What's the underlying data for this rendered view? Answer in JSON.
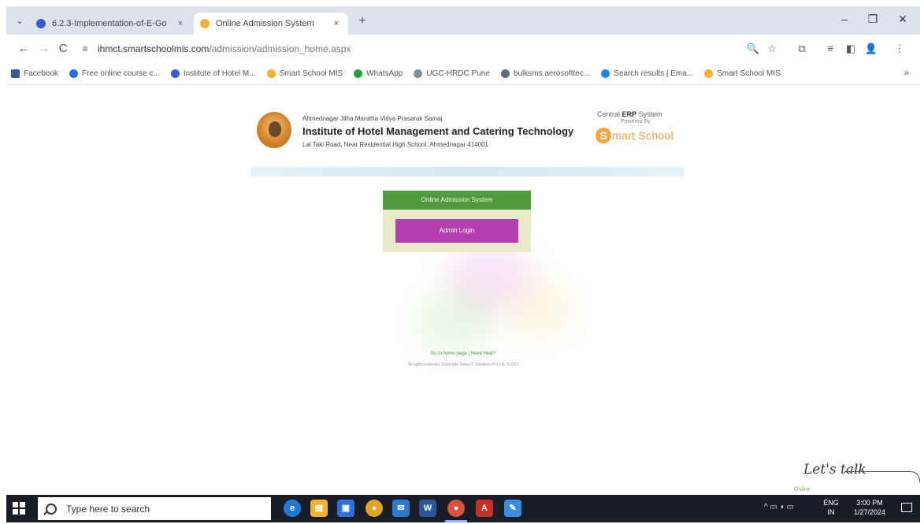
{
  "browser": {
    "tabs": [
      {
        "title": "6.2.3-Implementation-of-E-Go",
        "favicon_color": "#3a5bd9",
        "active": false
      },
      {
        "title": "Online Admission System",
        "favicon_color": "#f2b134",
        "active": true
      }
    ],
    "tab_close_glyph": "×",
    "new_tab_glyph": "+",
    "tab_dropdown_glyph": "⌄",
    "window_controls": {
      "minimize": "–",
      "restore": "❐",
      "close": "✕"
    },
    "nav": {
      "back": "←",
      "forward": "→",
      "reload": "C",
      "site_info": "≡"
    },
    "address": {
      "host": "ihmct.smartschoolmis.com",
      "path": "/admission/admission_home.aspx"
    },
    "toolbar_icons": {
      "zoom": "🔍",
      "bookmark": "☆",
      "extensions": "⧉",
      "reading_list": "≡",
      "side_panel": "◧",
      "profile": "👤",
      "menu": "⋮"
    },
    "bookmarks": [
      {
        "label": "Facebook",
        "color": "#3b5998"
      },
      {
        "label": "Free online course c...",
        "color": "#2b6fe0"
      },
      {
        "label": "Institute of Hotel M...",
        "color": "#3a5bd9"
      },
      {
        "label": "Smart School MIS",
        "color": "#f2b134"
      },
      {
        "label": "WhatsApp",
        "color": "#25a244"
      },
      {
        "label": "UGC-HRDC Pune",
        "color": "#7f8fa6"
      },
      {
        "label": "bulksms.aerosofttec...",
        "color": "#5d6b7a"
      },
      {
        "label": "Search results | Ema...",
        "color": "#1e88e5"
      },
      {
        "label": "Smart School MIS",
        "color": "#f2b134"
      }
    ],
    "bookmarks_more": "»"
  },
  "page": {
    "society": "Ahmednagar Jilha Maratha Vidya Prasarak Samaj",
    "institute": "Institute of Hotel Management and Catering Technology",
    "address": "Lal Taki Road, Near Residential High School, Ahmednagar 414001",
    "erp_prefix": "Central",
    "erp_bold": "ERP",
    "erp_suffix": "System",
    "powered": "Powered By",
    "brand_initial": "S",
    "brand_rest": "mart School",
    "admission_title": "Online Admission System",
    "admin_login": "Admin Login",
    "footer_link": "Go to home page | Need Help?",
    "footer_copy": "All rights reserved. Copyright Tebra IT Solutions Pvt Ltd. ©2024",
    "chat_label": "Let's talk",
    "chat_status": "Online"
  },
  "taskbar": {
    "search_placeholder": "Type here to search",
    "apps": [
      {
        "name": "edge",
        "glyph": "e",
        "color": "#1f7ad6"
      },
      {
        "name": "file-explorer",
        "glyph": "▤",
        "color": "#f0b429"
      },
      {
        "name": "store",
        "glyph": "▣",
        "color": "#2f6fd8"
      },
      {
        "name": "chrome",
        "glyph": "●",
        "color": "#e0a526"
      },
      {
        "name": "mail",
        "glyph": "✉",
        "color": "#2a7bd0"
      },
      {
        "name": "word",
        "glyph": "W",
        "color": "#2b579a"
      },
      {
        "name": "chrome-profile",
        "glyph": "●",
        "color": "#d9533c"
      },
      {
        "name": "acrobat",
        "glyph": "A",
        "color": "#c4312a"
      },
      {
        "name": "paint",
        "glyph": "✎",
        "color": "#3a8dde"
      }
    ],
    "tray_icons": "^ ▭ ◖ ▭",
    "lang_top": "ENG",
    "lang_bottom": "IN",
    "time": "3:00 PM",
    "date": "1/27/2024"
  }
}
